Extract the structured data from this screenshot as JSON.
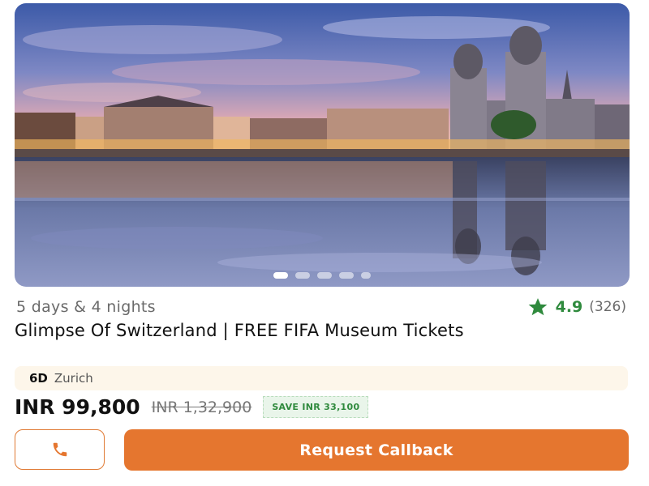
{
  "hero": {
    "carousel_total": 5,
    "carousel_active_index": 0
  },
  "card": {
    "duration": "5 days & 4 nights",
    "rating": {
      "value": "4.9",
      "count": "(326)",
      "star_color": "#2f8a3d"
    },
    "title": "Glimpse Of Switzerland | FREE FIFA Museum Tickets",
    "itinerary": {
      "days": "6D",
      "city": "Zurich"
    },
    "price": {
      "current": "INR 99,800",
      "original": "INR 1,32,900",
      "save": "SAVE INR 33,100"
    },
    "actions": {
      "phone_icon": "phone-icon",
      "callback_label": "Request Callback"
    }
  },
  "colors": {
    "accent": "#e5762f",
    "success": "#2f8a3d",
    "itinerary_bg": "#fdf6ea"
  }
}
